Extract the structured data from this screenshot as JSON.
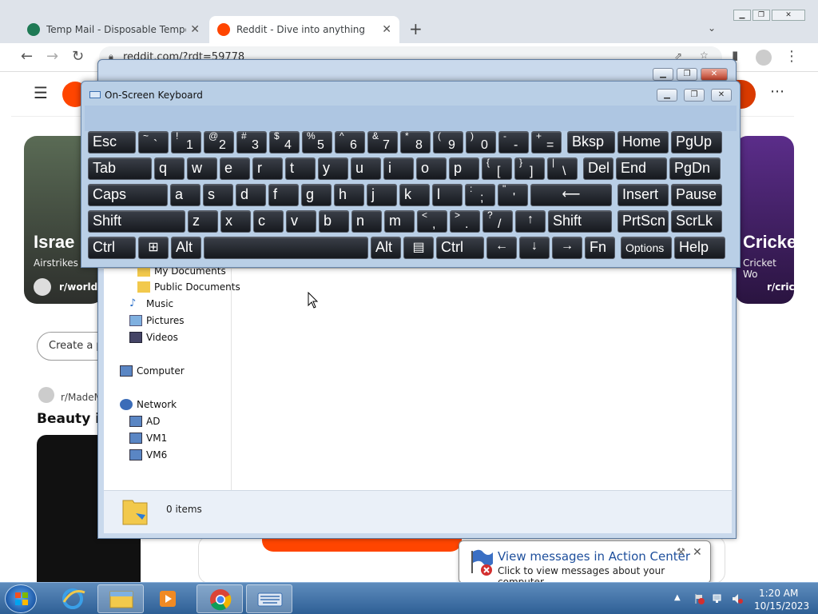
{
  "browser": {
    "tabs": [
      {
        "title": "Temp Mail - Disposable Tempora",
        "favicon_color": "#1f7a55"
      },
      {
        "title": "Reddit - Dive into anything",
        "favicon_color": "#ff4500"
      }
    ],
    "new_tab_label": "+",
    "url": "reddit.com/?rdt=59778",
    "icons": [
      "back-icon",
      "forward-icon",
      "reload-icon",
      "lock-icon",
      "share-icon",
      "star-icon",
      "sidebar-icon",
      "profile-icon",
      "menu-icon"
    ]
  },
  "reddit": {
    "cards": [
      {
        "title": "Israe",
        "subtitle": "Airstrikes",
        "subreddit": "r/worldn"
      },
      {
        "title": "Cricke",
        "subtitle": "Cricket Wo",
        "subreddit": "r/cric"
      }
    ],
    "create_post": "Create a p",
    "post_subreddit": "r/MadeM",
    "post_title": "Beauty is"
  },
  "explorer": {
    "nav": [
      {
        "label": "My Documents",
        "icon": "folder-icon"
      },
      {
        "label": "Public Documents",
        "icon": "folder-icon"
      },
      {
        "label": "Music",
        "icon": "music-icon"
      },
      {
        "label": "Pictures",
        "icon": "pictures-icon"
      },
      {
        "label": "Videos",
        "icon": "videos-icon"
      },
      {
        "label": "Computer",
        "icon": "computer-icon"
      },
      {
        "label": "Network",
        "icon": "network-icon"
      },
      {
        "label": "AD",
        "icon": "computer-icon"
      },
      {
        "label": "VM1",
        "icon": "computer-icon"
      },
      {
        "label": "VM6",
        "icon": "computer-icon"
      }
    ],
    "items_count": "0 items"
  },
  "osk": {
    "title": "On-Screen Keyboard",
    "rows": [
      [
        {
          "main": "Esc"
        },
        {
          "sub": "~",
          "main": "`"
        },
        {
          "sub": "!",
          "main": "1"
        },
        {
          "sub": "@",
          "main": "2"
        },
        {
          "sub": "#",
          "main": "3"
        },
        {
          "sub": "$",
          "main": "4"
        },
        {
          "sub": "%",
          "main": "5"
        },
        {
          "sub": "^",
          "main": "6"
        },
        {
          "sub": "&",
          "main": "7"
        },
        {
          "sub": "*",
          "main": "8"
        },
        {
          "sub": "(",
          "main": "9"
        },
        {
          "sub": ")",
          "main": "0"
        },
        {
          "sub": "-",
          "main": "-"
        },
        {
          "sub": "+",
          "main": "="
        },
        {
          "main": "Bksp"
        },
        {
          "main": "Home"
        },
        {
          "main": "PgUp"
        }
      ],
      [
        {
          "main": "Tab"
        },
        {
          "main": "q"
        },
        {
          "main": "w"
        },
        {
          "main": "e"
        },
        {
          "main": "r"
        },
        {
          "main": "t"
        },
        {
          "main": "y"
        },
        {
          "main": "u"
        },
        {
          "main": "i"
        },
        {
          "main": "o"
        },
        {
          "main": "p"
        },
        {
          "sub": "{",
          "main": "["
        },
        {
          "sub": "}",
          "main": "]"
        },
        {
          "sub": "|",
          "main": "\\"
        },
        {
          "main": "Del"
        },
        {
          "main": "End"
        },
        {
          "main": "PgDn"
        }
      ],
      [
        {
          "main": "Caps"
        },
        {
          "main": "a"
        },
        {
          "main": "s"
        },
        {
          "main": "d"
        },
        {
          "main": "f"
        },
        {
          "main": "g"
        },
        {
          "main": "h"
        },
        {
          "main": "j"
        },
        {
          "main": "k"
        },
        {
          "main": "l"
        },
        {
          "sub": ":",
          "main": ";"
        },
        {
          "sub": "\"",
          "main": "'"
        },
        {
          "main": "⟵"
        },
        {
          "main": "Insert"
        },
        {
          "main": "Pause"
        }
      ],
      [
        {
          "main": "Shift"
        },
        {
          "main": "z"
        },
        {
          "main": "x"
        },
        {
          "main": "c"
        },
        {
          "main": "v"
        },
        {
          "main": "b"
        },
        {
          "main": "n"
        },
        {
          "main": "m"
        },
        {
          "sub": "<",
          "main": ","
        },
        {
          "sub": ">",
          "main": "."
        },
        {
          "sub": "?",
          "main": "/"
        },
        {
          "main": "↑"
        },
        {
          "main": "Shift"
        },
        {
          "main": "PrtScn"
        },
        {
          "main": "ScrLk"
        }
      ],
      [
        {
          "main": "Ctrl"
        },
        {
          "main": "⊞"
        },
        {
          "main": "Alt"
        },
        {
          "main": ""
        },
        {
          "main": "Alt"
        },
        {
          "main": "▤"
        },
        {
          "main": "Ctrl"
        },
        {
          "main": "←"
        },
        {
          "main": "↓"
        },
        {
          "main": "→"
        },
        {
          "main": "Fn"
        },
        {
          "main": "Options"
        },
        {
          "main": "Help"
        }
      ]
    ]
  },
  "notification": {
    "title": "View messages in Action Center",
    "text": "Click to view messages about your computer.",
    "close": "✕"
  },
  "taskbar": {
    "apps": [
      "internet-explorer-icon",
      "explorer-icon",
      "media-player-icon",
      "chrome-icon",
      "on-screen-keyboard-icon"
    ],
    "time": "1:20 AM",
    "date": "10/15/2023"
  }
}
